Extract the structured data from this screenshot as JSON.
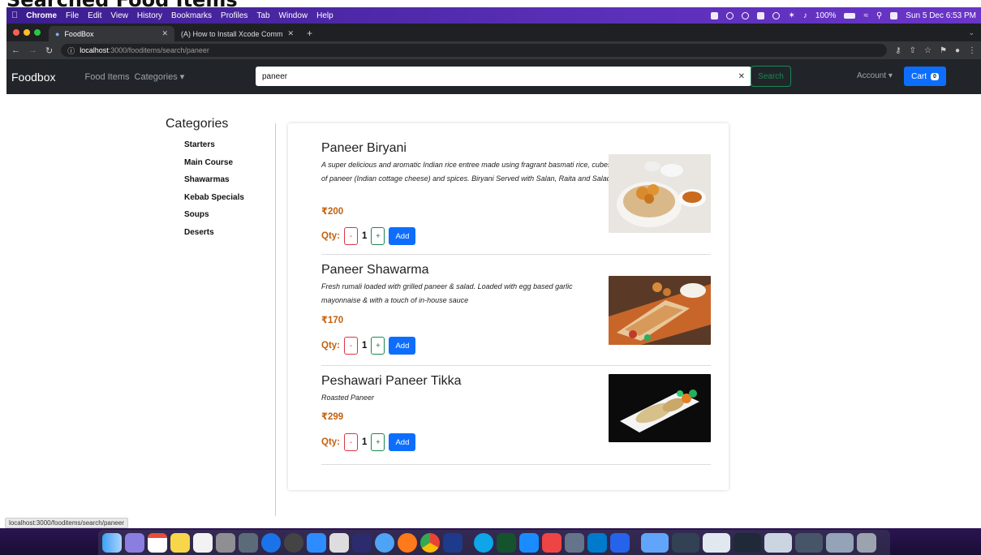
{
  "page_heading": "Searched Food Items",
  "menubar": {
    "app": "Chrome",
    "items": [
      "File",
      "Edit",
      "View",
      "History",
      "Bookmarks",
      "Profiles",
      "Tab",
      "Window",
      "Help"
    ],
    "battery": "100%",
    "datetime": "Sun 5 Dec 6:53 PM"
  },
  "tabs": [
    {
      "title": "FoodBox"
    },
    {
      "title": "(A) How to Install Xcode Comman"
    }
  ],
  "address": {
    "host": "localhost",
    "path": ":3000/fooditems/search/paneer"
  },
  "navbar": {
    "brand": "Foodbox",
    "links": [
      "Food Items",
      "Categories ▾"
    ],
    "search_value": "paneer",
    "search_button": "Search",
    "account": "Account ▾",
    "cart_label": "Cart",
    "cart_count": "0"
  },
  "categories": {
    "title": "Categories",
    "items": [
      "Starters",
      "Main Course",
      "Shawarmas",
      "Kebab Specials",
      "Soups",
      "Deserts"
    ]
  },
  "food_items": [
    {
      "name": "Paneer Biryani",
      "description": "A super delicious and aromatic Indian rice entree made using fragrant basmati rice, cubes of paneer (Indian cottage cheese) and spices. Biryani Served with Salan, Raita and Salad.",
      "price": "₹200",
      "qty_label": "Qty:",
      "qty": "1",
      "minus": "-",
      "plus": "+",
      "add": "Add"
    },
    {
      "name": "Paneer Shawarma",
      "description": "Fresh rumali loaded with grilled paneer & salad. Loaded with egg based garlic mayonnaise & with a touch of in-house sauce",
      "price": "₹170",
      "qty_label": "Qty:",
      "qty": "1",
      "minus": "-",
      "plus": "+",
      "add": "Add"
    },
    {
      "name": "Peshawari Paneer Tikka",
      "description": "Roasted Paneer",
      "price": "₹299",
      "qty_label": "Qty:",
      "qty": "1",
      "minus": "-",
      "plus": "+",
      "add": "Add"
    }
  ],
  "status_url": "localhost:3000/fooditems/search/paneer"
}
